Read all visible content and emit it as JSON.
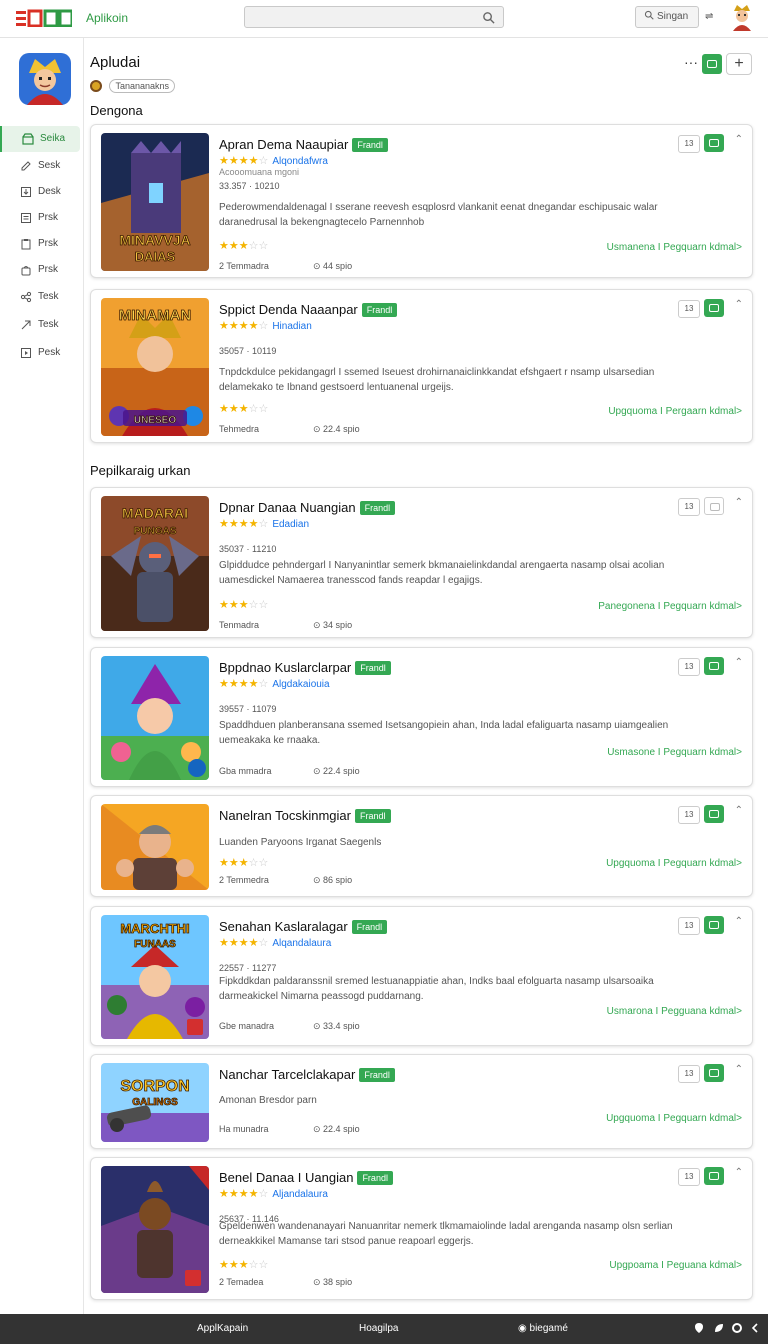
{
  "topbar": {
    "logo_text": "Aplikoin",
    "signin_label": "Singan",
    "arrow_glyph": "⇌"
  },
  "sidebar": {
    "items": [
      {
        "label": "Seika",
        "icon": "store-icon",
        "active": true
      },
      {
        "label": "Sesk",
        "icon": "edit-icon"
      },
      {
        "label": "Desk",
        "icon": "download-icon"
      },
      {
        "label": "Prsk",
        "icon": "list-icon"
      },
      {
        "label": "Prsk",
        "icon": "clipboard-icon"
      },
      {
        "label": "Prsk",
        "icon": "bag-icon"
      },
      {
        "label": "Tesk",
        "icon": "share-icon"
      },
      {
        "label": "Tesk",
        "icon": "shortcut-icon"
      },
      {
        "label": "Pesk",
        "icon": "play-box-icon"
      }
    ]
  },
  "header": {
    "title": "Apludai",
    "chip": "Tanananakns",
    "more": "···",
    "plus": "+"
  },
  "sections": {
    "first": "Dengona",
    "second": "Pepilkaraig urkan"
  },
  "cards": [
    {
      "title": "Apran Dema Naaupiar",
      "badge": "Frandl",
      "stars": 4,
      "author": "Alqondafwra",
      "subline": "Acooomuana mgoni",
      "meta": "33.357 · 10210",
      "desc": "Pederowmendaldenagal I sserane reevesh esqplosrd vlankanit eenat dnegandar eschipusaic walar daranedrusal la bekengnagtecelo Parnennhob",
      "stars2": 3,
      "foot1": "2 Temmadra",
      "foot2": "44 spio",
      "link": "Usmanena I Pegquarn kdmal>",
      "btn": "13",
      "btn_plain": false,
      "art": "tower",
      "thumb_text": [
        "MINAVVJA",
        "DAIAS"
      ]
    },
    {
      "title": "Sppict Denda Naaanpar",
      "badge": "Frandl",
      "stars": 4,
      "author": "Hinadian",
      "meta": "35057 · 10119",
      "desc": "Tnpdckdulce pekidangagrl I ssemed Iseuest drohirnanaiclinkkandat efshgaert r nsamp ulsarsedian delamekako te Ibnand gestsoerd lentuanenal urgeijs.",
      "stars2": 3,
      "foot1": "Tehmedra",
      "foot2": "22.4 spio",
      "link": "Upgquoma I Pergaarn kdmal>",
      "btn": "13",
      "btn_plain": false,
      "art": "warrior",
      "thumb_text": [
        "MINAMAN",
        "UNESEO"
      ]
    },
    {
      "title": "Dpnar Danaa Nuangian",
      "badge": "Frandl",
      "stars": 4,
      "author": "Edadian",
      "meta": "35037 · 11210",
      "desc": "Glpiddudce pehndergarl I Nanyanintlar semerk bkmanaielinkdandal arengaerta nasamp olsai acolian uamesdickel Namaerea tranesscod fands reapdar l egajigs.",
      "stars2": 3,
      "foot1": "Tenmadra",
      "foot2": "34 spio",
      "link": "Panegonena I Pegquarn kdmal>",
      "btn": "13",
      "btn_plain": true,
      "art": "knight",
      "thumb_text": [
        "MADARAI",
        "PUNGAS"
      ]
    },
    {
      "title": "Bppdnao Kuslarclarpar",
      "badge": "Frandl",
      "stars": 4,
      "author": "Algdakaiouia",
      "meta": "39557 · 11079",
      "desc": "Spaddhduen planberansana ssemed Isetsangopiein ahan, Inda ladal efaliguarta nasamp uiamgealien uemeakaka ke rnaaka.",
      "stars2": 0,
      "foot1": "Gba mmadra",
      "foot2": "22.4 spio",
      "link": "Usmasone I Pegquarn kdmal>",
      "btn": "13",
      "btn_plain": false,
      "art": "gnome",
      "thumb_text": []
    },
    {
      "title": "Nanelran Tocskinmgiar",
      "badge": "Frandl",
      "stars": 0,
      "author": "",
      "meta": "",
      "desc": "Luanden Paryoons Irganat Saegenls",
      "stars2": 3,
      "foot1": "2 Temmedra",
      "foot2": "86 spio",
      "link": "Upgquoma I Pegquarn kdmal>",
      "btn": "13",
      "btn_plain": false,
      "art": "brawler",
      "thumb_text": []
    },
    {
      "title": "Senahan Kaslaralagar",
      "badge": "Frandl",
      "stars": 4,
      "author": "Alqandalaura",
      "meta": "22557 · 11277",
      "desc": "Fipkddkdan paldaranssnil sremed lestuanappiatie ahan, Indks baal efolguarta nasamp ulsarsoaika darmeakickel Nimarna peassogd puddarnang.",
      "stars2": 0,
      "foot1": "Gbe manadra",
      "foot2": "33.4 spio",
      "link": "Usmarona I Pegguana kdmal>",
      "btn": "13",
      "btn_plain": false,
      "art": "archer",
      "thumb_text": [
        "MARCHTHI",
        "FUNAAS"
      ]
    },
    {
      "title": "Nanchar Tarcelclakapar",
      "badge": "Frandl",
      "stars": 0,
      "author": "",
      "meta": "",
      "desc": "Amonan Bresdor parn",
      "stars2": 0,
      "foot1": "Ha munadra",
      "foot2": "22.4 spio",
      "link": "Upgquoma I Pegquarn kdmal>",
      "btn": "13",
      "btn_plain": false,
      "art": "cannon",
      "thumb_text": [
        "SORPON",
        "GALINGS"
      ]
    },
    {
      "title": "Benel Danaa I Uangian",
      "badge": "Frandl",
      "stars": 4,
      "author": "Aljandalaura",
      "meta": "25637 · 11.146",
      "desc": "Gpeldenwen wandenanayari Nanuanritar nemerk tlkmamaiolinde ladal arenganda nasamp olsn serlian derneakkikel Mamanse tari stsod panue reapoarl eggerjs.",
      "stars2": 3,
      "foot1": "2 Temadea",
      "foot2": "38 spio",
      "link": "Upgpoama I Peguana kdmal>",
      "btn": "13",
      "btn_plain": false,
      "art": "demon",
      "thumb_text": []
    }
  ],
  "bottombar": {
    "left": "ApplKapain",
    "center": "Hoagilpa",
    "right": "biegamé"
  },
  "colors": {
    "accent_green": "#34a853",
    "link_blue": "#1a73e8",
    "star": "#f4b400"
  }
}
